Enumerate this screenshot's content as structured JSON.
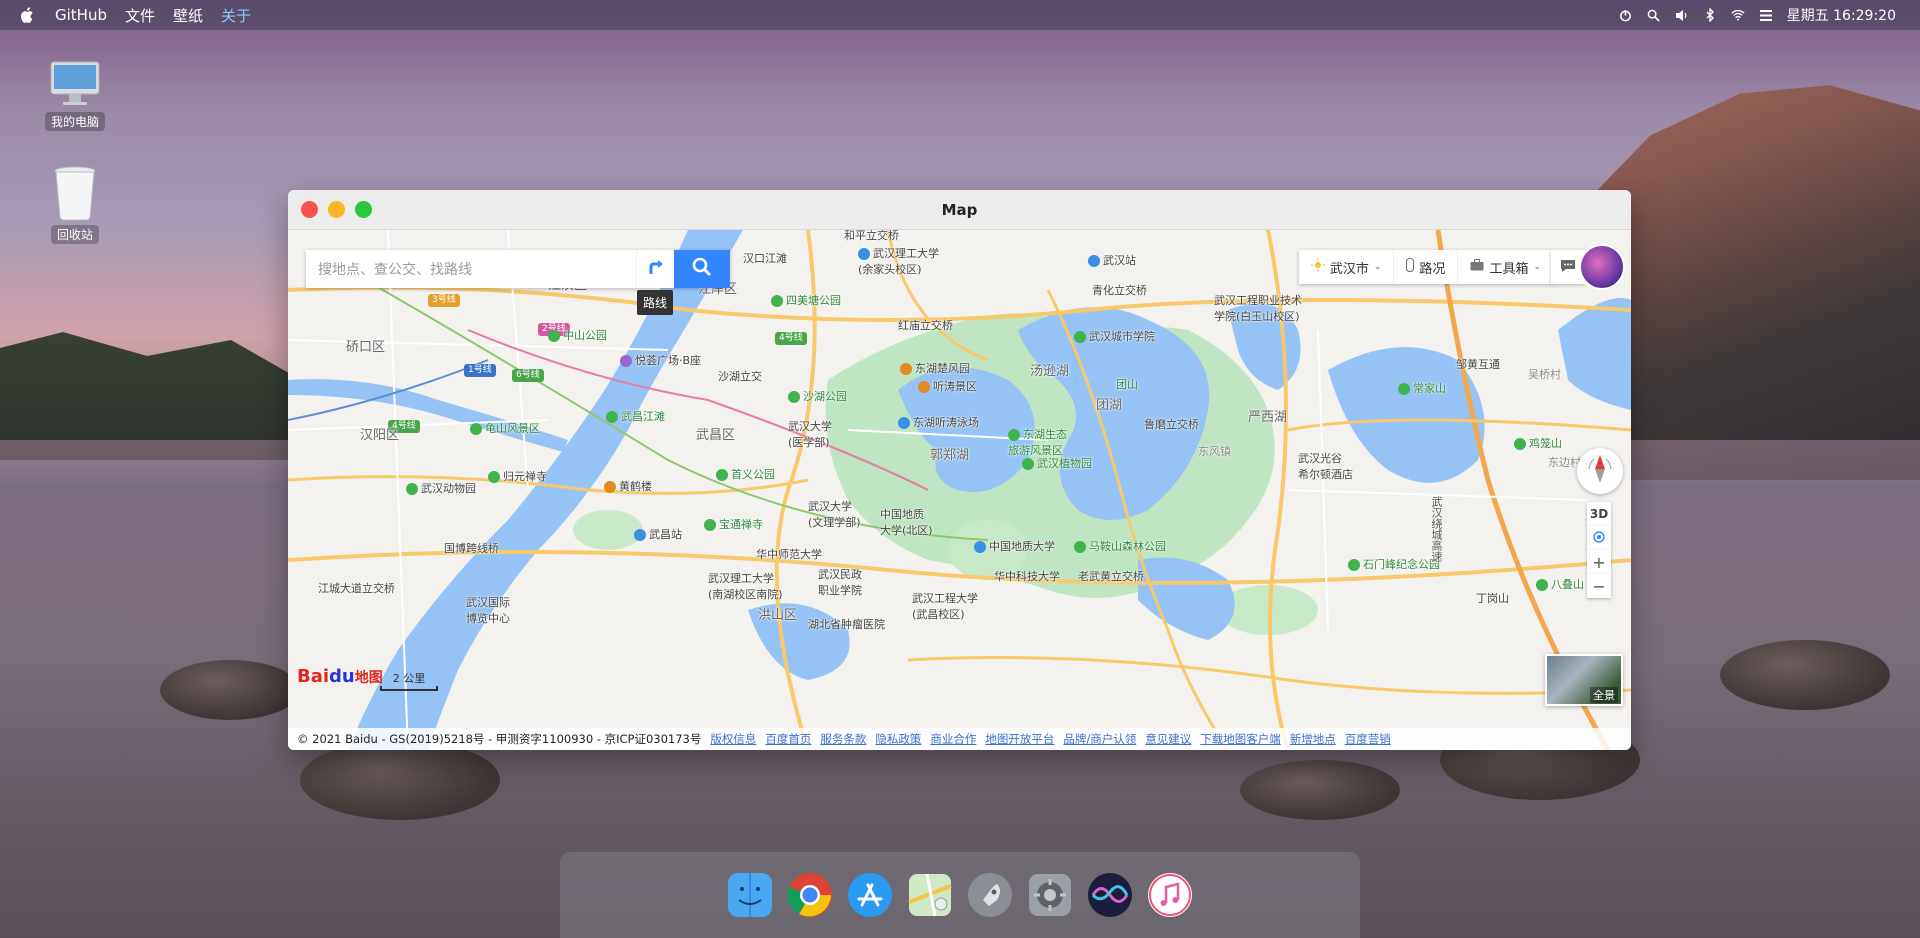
{
  "menubar": {
    "apple_icon": "apple-icon",
    "items": [
      "GitHub",
      "文件",
      "壁纸",
      "关于"
    ],
    "active_index": 3,
    "clock": "星期五 16:29:20",
    "tray_icons": [
      "power-icon",
      "search-icon",
      "volume-icon",
      "bluetooth-icon",
      "wifi-icon",
      "list-icon"
    ]
  },
  "desktop": {
    "icons": [
      {
        "label": "我的电脑",
        "icon": "computer-icon"
      },
      {
        "label": "回收站",
        "icon": "trash-icon"
      }
    ]
  },
  "window": {
    "title": "Map"
  },
  "map": {
    "search": {
      "placeholder": "搜地点、查公交、找路线",
      "value": "",
      "route_tooltip": "路线"
    },
    "toolbar": {
      "city": "武汉市",
      "traffic": "路况",
      "toolbox": "工具箱"
    },
    "controls": {
      "three_d": "3D",
      "zoom_in": "+",
      "zoom_out": "−",
      "panorama": "全景"
    },
    "logo": {
      "bai": "Bai",
      "du": "du",
      "map": "地图"
    },
    "scale": "2 公里",
    "labels": {
      "hepingliqiao": "和平立交桥",
      "wuhanligong_yujiatou": "武汉理工大学\n(余家头校区)",
      "wuhanzhan": "武汉站",
      "qinghualijiaoqiao": "青化立交桥",
      "jiang_an": "江岸区",
      "jianghan": "江汉区",
      "hankoujiangtan": "汉口江滩",
      "siweitang": "四美塘公园",
      "qiaokou": "硚口区",
      "zhongshan_park": "中山公园",
      "yuefu": "悦荟广场·B座",
      "honggang": "红庙立交桥",
      "dongchu": "东湖楚风园",
      "tingtao": "听涛景区",
      "tanglin": "汤逊湖",
      "wuhan_city_college": "武汉城市学院",
      "shahu_lijiao": "沙湖立交",
      "shahu_park": "沙湖公园",
      "guishan": "龟山风景区",
      "hanyang": "汉阳区",
      "wuchang": "武昌区",
      "wuchangjiangtan": "武昌江滩",
      "wuhan_univ_med": "武汉大学\n(医学部)",
      "donghu_swim": "东湖听涛泳场",
      "luojia": "郭郑湖",
      "donghu_eco": "东湖生态\n旅游风景区",
      "wuhan_botanical": "武汉植物园",
      "tuanshan": "团山",
      "tuan": "团湖",
      "moshan_lijiao": "鲁磨立交桥",
      "yanxihu": "严西湖",
      "dongfeng": "东风镇",
      "wuhan_zoo": "武汉动物园",
      "guiyuan": "归元禅寺",
      "huanghelou": "黄鹤楼",
      "shouyi": "首义公园",
      "wuhan_univ_lit": "武汉大学\n(文理学部)",
      "geo_univ_north": "中国地质\n大学(北区)",
      "wuchangzhan": "武昌站",
      "baotong": "宝通禅寺",
      "hanyang_bridge": "国博跨线桥",
      "geo_univ": "中国地质大学",
      "hust": "华中科技大学",
      "maanshan": "马鞍山森林公园",
      "laowuhuang": "老武黄立交桥",
      "ccnu": "华中师范大学",
      "wuhan_civil": "武汉民政\n职业学院",
      "wuhan_ligong_nanhu": "武汉理工大学\n(南湖校区南院)",
      "hubei_cancer": "湖北省肿瘤医院",
      "wust": "武汉工程大学\n(武昌校区)",
      "hongshan": "洪山区",
      "wuhan_expo": "武汉国际\n博览中心",
      "jiangcheng": "江城大道立交桥",
      "wuhan_vocational": "武汉工程职业技术\n学院(白玉山校区)",
      "zhouhuang": "邹黄互通",
      "changyishan": "常家山",
      "wuhan_guanggu_hilton": "武汉光谷\n希尔顿酒店",
      "qiaoshan": "鸡笼山",
      "shimen": "石门峰纪念公园",
      "bayishan": "八叠山",
      "dingshan": "丁岗山",
      "wuhan_ring": "武汉绕城高速",
      "xiantao": "吴桥村",
      "dongtai": "东边村"
    },
    "road_tags": {
      "line3": "3号线",
      "line2": "2号线",
      "line1": "1号线",
      "line6": "6号线",
      "line4a": "4号线",
      "line4b": "4号线"
    },
    "footer": {
      "copyright": "© 2021 Baidu - GS(2019)5218号 - 甲测资字1100930 - 京ICP证030173号",
      "links": [
        "版权信息",
        "百度首页",
        "服务条款",
        "隐私政策",
        "商业合作",
        "地图开放平台",
        "品牌/商户认领",
        "意见建议",
        "下载地图客户端",
        "新增地点",
        "百度营销"
      ]
    }
  },
  "dock": {
    "apps": [
      "finder-icon",
      "chrome-icon",
      "app-store-icon",
      "maps-icon",
      "launchpad-icon",
      "settings-icon",
      "siri-icon",
      "music-icon"
    ]
  },
  "colors": {
    "search_blue": "#3385ff",
    "water": "#96c3f5",
    "park": "#bfe5c2",
    "road_major": "#f7c96b"
  }
}
